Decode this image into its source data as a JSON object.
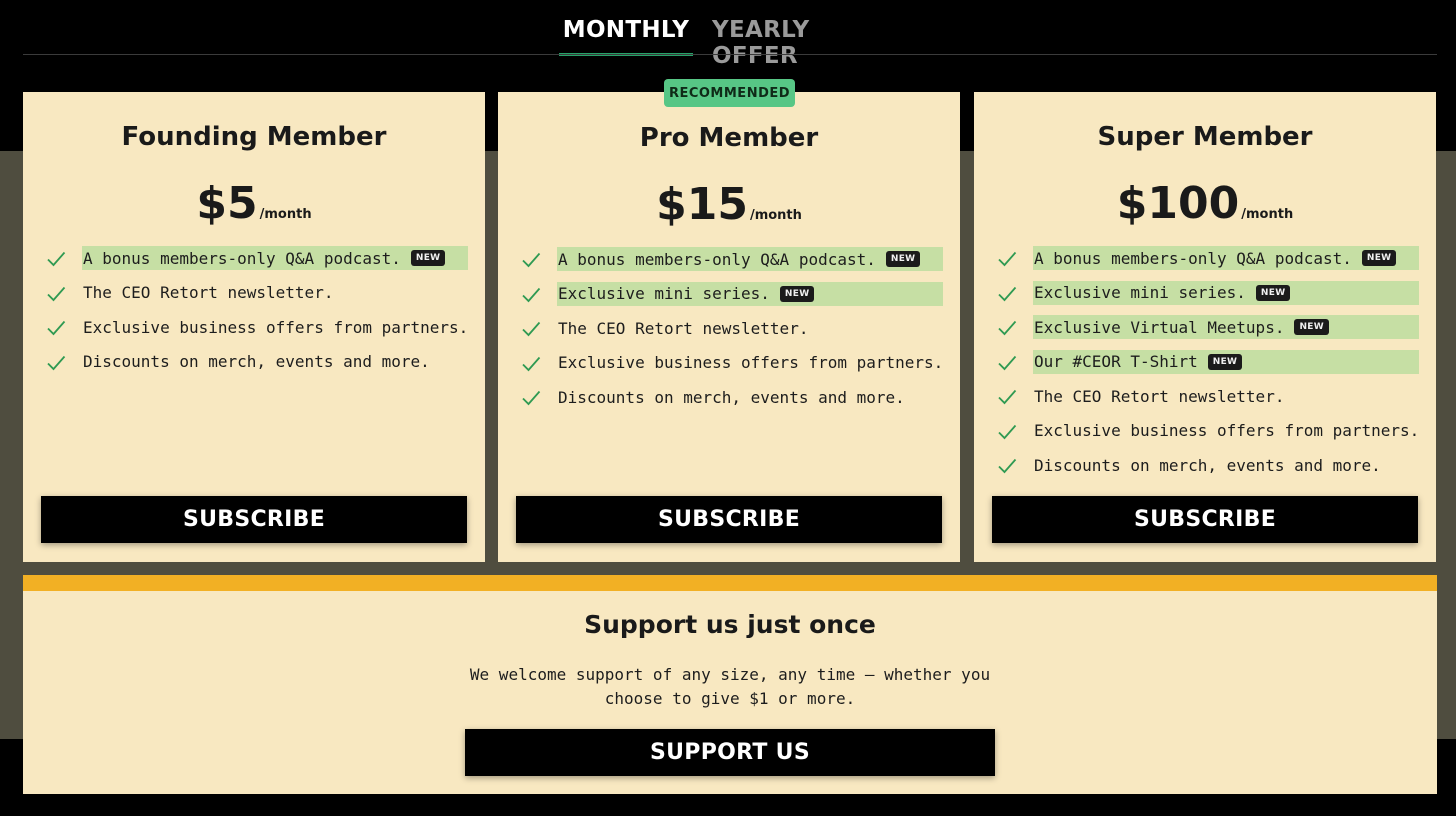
{
  "tabs": [
    {
      "label": "MONTHLY",
      "active": true
    },
    {
      "label": "YEARLY OFFER",
      "active": false
    }
  ],
  "recommended_badge": "RECOMMENDED",
  "new_badge": "NEW",
  "plans": [
    {
      "name": "Founding Member",
      "price": "$5",
      "period": "/month",
      "features": [
        {
          "text": "A bonus members-only Q&A podcast.",
          "new": true
        },
        {
          "text": "The CEO Retort newsletter.",
          "new": false
        },
        {
          "text": "Exclusive business offers from partners.",
          "new": false
        },
        {
          "text": "Discounts on merch, events and more.",
          "new": false
        }
      ],
      "button": "SUBSCRIBE"
    },
    {
      "name": "Pro Member",
      "price": "$15",
      "period": "/month",
      "recommended": true,
      "features": [
        {
          "text": "A bonus members-only Q&A podcast.",
          "new": true
        },
        {
          "text": "Exclusive mini series.",
          "new": true
        },
        {
          "text": "The CEO Retort newsletter.",
          "new": false
        },
        {
          "text": "Exclusive business offers from partners.",
          "new": false
        },
        {
          "text": "Discounts on merch, events and more.",
          "new": false
        }
      ],
      "button": "SUBSCRIBE"
    },
    {
      "name": "Super Member",
      "price": "$100",
      "period": "/month",
      "features": [
        {
          "text": "A bonus members-only Q&A podcast.",
          "new": true
        },
        {
          "text": "Exclusive mini series.",
          "new": true
        },
        {
          "text": "Exclusive Virtual Meetups.",
          "new": true
        },
        {
          "text": "Our #CEOR T-Shirt",
          "new": true
        },
        {
          "text": "The CEO Retort newsletter.",
          "new": false
        },
        {
          "text": "Exclusive business offers from partners.",
          "new": false
        },
        {
          "text": "Discounts on merch, events and more.",
          "new": false
        }
      ],
      "button": "SUBSCRIBE"
    }
  ],
  "support": {
    "title": "Support us just once",
    "text": "We welcome support of any size, any time – whether you choose to give $1 or more.",
    "button": "SUPPORT US"
  },
  "colors": {
    "background": "#000000",
    "band": "#4f4d3f",
    "card": "#f8e8c1",
    "highlight": "#c6dfa4",
    "check": "#2f9a52",
    "active_tab_underline": "#26a269",
    "recommended_badge": "#57c685",
    "support_accent": "#f2b024"
  },
  "icons": {
    "feature": "checkmark-icon"
  }
}
